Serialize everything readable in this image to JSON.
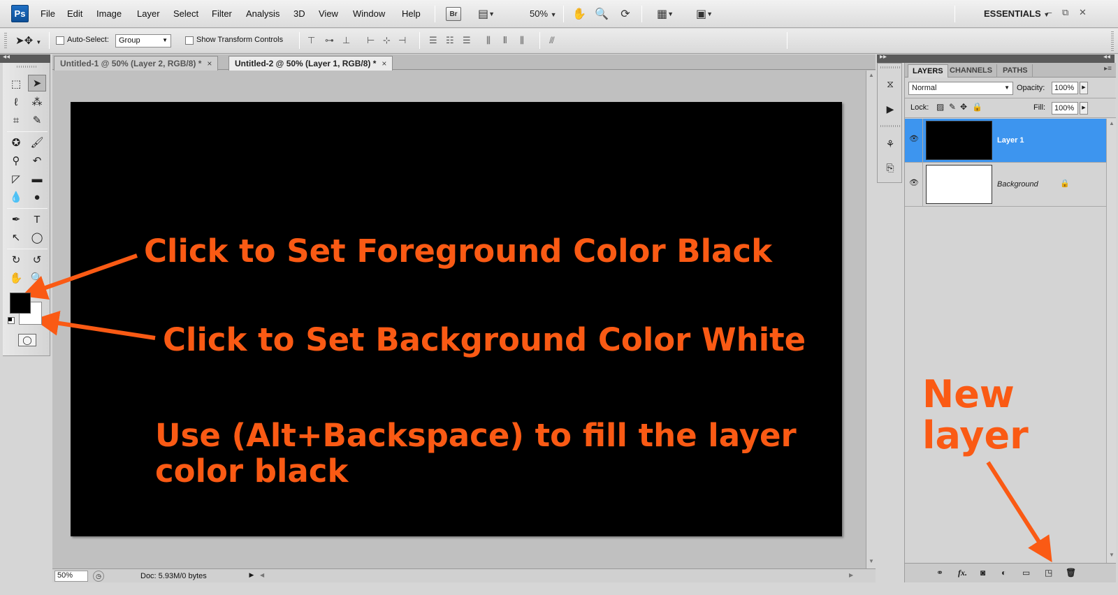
{
  "menubar": {
    "logo": "Ps",
    "items": [
      "File",
      "Edit",
      "Image",
      "Layer",
      "Select",
      "Filter",
      "Analysis",
      "3D",
      "View",
      "Window",
      "Help"
    ],
    "bridge": "Br",
    "zoom": "50%",
    "workspace": "ESSENTIALS"
  },
  "options": {
    "auto_select_label": "Auto-Select:",
    "auto_select_value": "Group",
    "show_transform_label": "Show Transform Controls"
  },
  "tabs": [
    {
      "title": "Untitled-1 @ 50% (Layer 2, RGB/8) *",
      "close": "×"
    },
    {
      "title": "Untitled-2 @ 50% (Layer 1, RGB/8) *",
      "close": "×"
    }
  ],
  "status": {
    "zoom": "50%",
    "doc": "Doc: 5.93M/0 bytes"
  },
  "layers_panel": {
    "tabs": [
      "LAYERS",
      "CHANNELS",
      "PATHS"
    ],
    "blend_mode": "Normal",
    "opacity_label": "Opacity:",
    "opacity": "100%",
    "lock_label": "Lock:",
    "fill_label": "Fill:",
    "fill": "100%",
    "layers": [
      {
        "name": "Layer 1",
        "thumb_color": "#000000",
        "selected": true
      },
      {
        "name": "Background",
        "thumb_color": "#ffffff",
        "selected": false
      }
    ],
    "footer_fx": "fx."
  },
  "annotations": {
    "foreground": "Click to Set Foreground Color Black",
    "background": "Click to Set Background Color White",
    "fill_line1": "Use (Alt+Backspace)  to fill the layer",
    "fill_line2": "color black",
    "new_layer_line1": "New",
    "new_layer_line2": "layer"
  },
  "colors": {
    "annotation": "#fa5a14",
    "selection": "#3d95ef",
    "foreground": "#000000",
    "background": "#ffffff"
  }
}
